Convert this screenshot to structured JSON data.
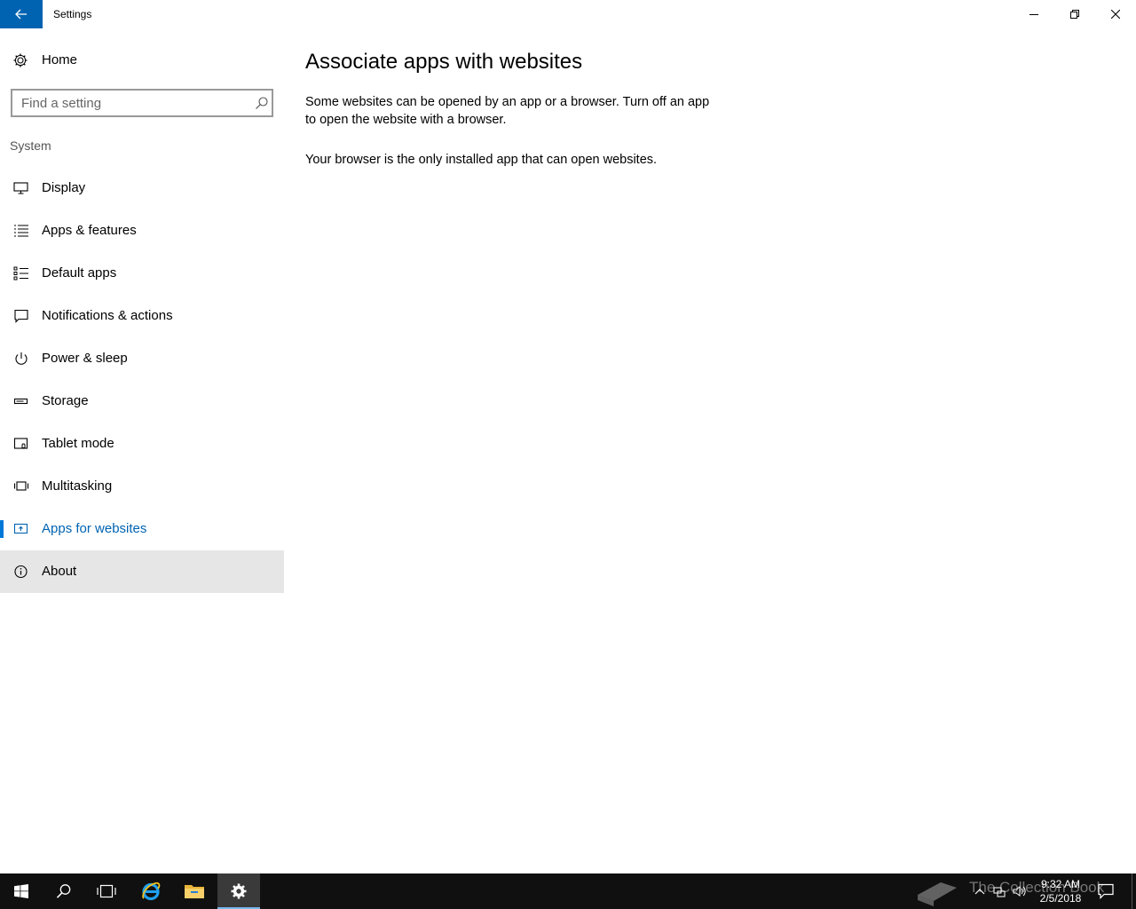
{
  "window": {
    "title": "Settings",
    "controls": [
      "minimize",
      "maximize",
      "close"
    ]
  },
  "sidebar": {
    "home_label": "Home",
    "search": {
      "placeholder": "Find a setting",
      "value": ""
    },
    "section_label": "System",
    "items": [
      {
        "label": "Display",
        "icon": "display-icon"
      },
      {
        "label": "Apps & features",
        "icon": "list-icon"
      },
      {
        "label": "Default apps",
        "icon": "default-apps-icon"
      },
      {
        "label": "Notifications & actions",
        "icon": "message-icon"
      },
      {
        "label": "Power & sleep",
        "icon": "power-icon"
      },
      {
        "label": "Storage",
        "icon": "storage-icon"
      },
      {
        "label": "Tablet mode",
        "icon": "tablet-icon"
      },
      {
        "label": "Multitasking",
        "icon": "multitasking-icon"
      },
      {
        "label": "Apps for websites",
        "icon": "web-app-icon",
        "selected": true
      },
      {
        "label": "About",
        "icon": "info-icon",
        "hovered": true
      }
    ]
  },
  "main": {
    "title": "Associate apps with websites",
    "description": "Some websites can be opened by an app or a browser.  Turn off an app to open the website with a browser.",
    "info": "Your browser is the only installed app that can open websites."
  },
  "taskbar": {
    "buttons": [
      "start",
      "search",
      "task-view",
      "internet-explorer",
      "file-explorer",
      "settings"
    ],
    "active": "settings",
    "watermark": "The Collection Book",
    "time": "9:32 AM",
    "date": "2/5/2018"
  },
  "colors": {
    "accent": "#0063b1",
    "selected_text": "#0063b1",
    "hover_bg": "#e6e6e6",
    "taskbar_bg": "#101010"
  }
}
